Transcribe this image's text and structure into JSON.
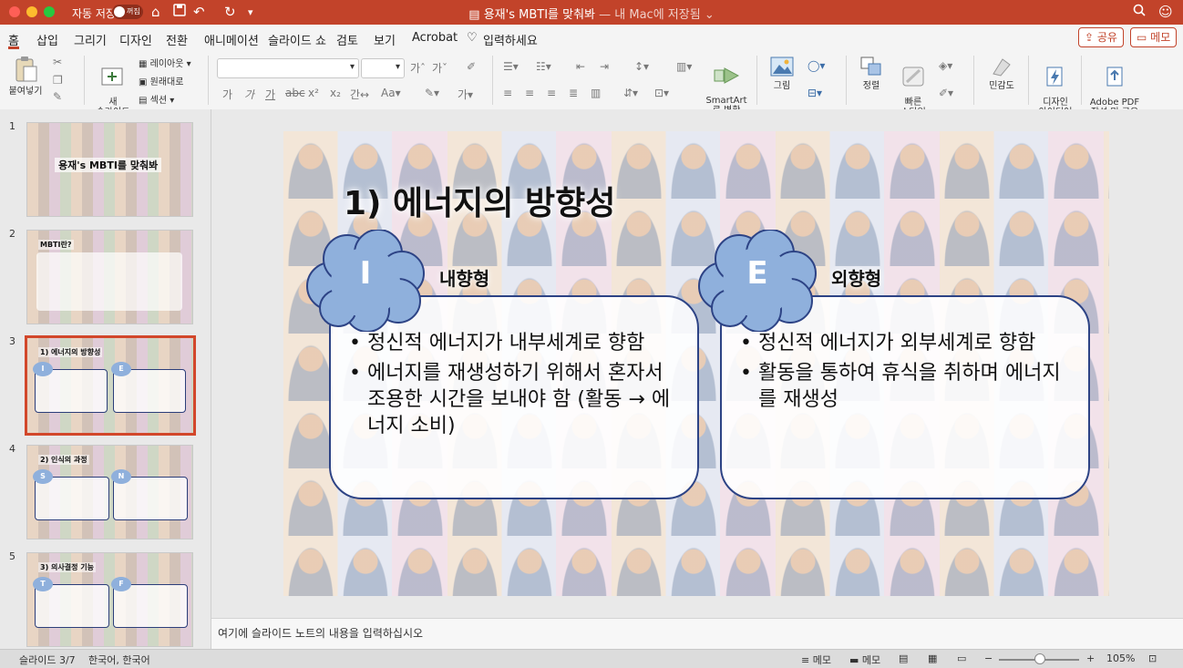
{
  "titlebar": {
    "autosave_label": "자동 저장",
    "autosave_state": "꺼짐",
    "doc_name": "용재's MBTI를 맞춰봐",
    "doc_location": "— 내 Mac에 저장됨",
    "icons": [
      "home-icon",
      "save-icon",
      "undo-icon",
      "redo-icon",
      "customize-icon",
      "search-icon",
      "smiley-icon"
    ]
  },
  "menu": {
    "items": [
      "홈",
      "삽입",
      "그리기",
      "디자인",
      "전환",
      "애니메이션",
      "슬라이드 쇼",
      "검토",
      "보기",
      "Acrobat"
    ],
    "tell_me": "입력하세요",
    "share": "공유",
    "memo": "메모"
  },
  "ribbon": {
    "paste": "붙여넣기",
    "new_slide": "새\n슬라이드",
    "layout": "레이아웃",
    "reset": "원래대로",
    "section": "섹션",
    "smartart": "SmartArt\n로 변환",
    "picture": "그림",
    "arrange": "정렬",
    "quick_styles": "빠른\n스타일",
    "sensitivity": "민감도",
    "design_ideas": "디자인\n아이디어",
    "adobe_pdf": "Adobe PDF\n작성 및 공유"
  },
  "slides": [
    {
      "num": "1",
      "title": "용재's MBTI를 맞춰봐"
    },
    {
      "num": "2",
      "title": "MBTI란?"
    },
    {
      "num": "3",
      "title": "1) 에너지의 방향성"
    },
    {
      "num": "4",
      "title": "2) 인식의 과정"
    },
    {
      "num": "5",
      "title": "3) 의사결정 기능"
    }
  ],
  "slide": {
    "title": "1) 에너지의 방향성",
    "left": {
      "letter": "I",
      "label": "내향형",
      "bullet1": "정신적 에너지가 내부세계로 향함",
      "bullet2": "에너지를 재생성하기 위해서 혼자서 조용한 시간을 보내야 함 (활동 → 에너지 소비)"
    },
    "right": {
      "letter": "E",
      "label": "외향형",
      "bullet1": "정신적 에너지가 외부세계로 향함",
      "bullet2": "활동을 통하여 휴식을 취하며 에너지를 재생성"
    }
  },
  "notes": {
    "placeholder": "여기에 슬라이드 노트의 내용을 입력하십시오"
  },
  "status": {
    "slide_pos": "슬라이드 3/7",
    "language": "한국어, 한국어",
    "notes_btn": "메모",
    "comments_btn": "메모",
    "zoom": "105%"
  },
  "colors": {
    "accent": "#c2432a",
    "cloud": "#8fb0dc",
    "panel_border": "#2d4385"
  }
}
